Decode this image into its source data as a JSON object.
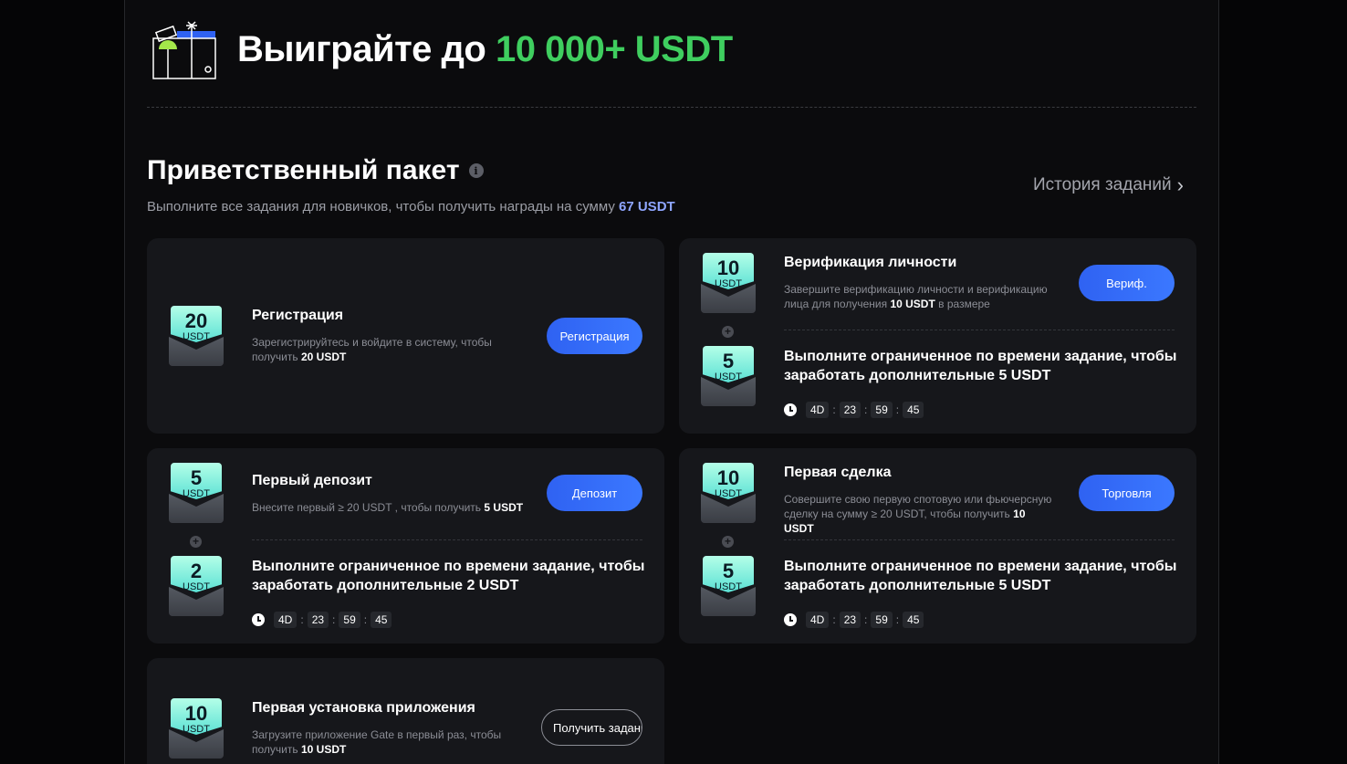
{
  "hero": {
    "title": "Выиграйте до",
    "amount": "10 000+ USDT"
  },
  "section": {
    "title": "Приветственный пакет",
    "subtitle": "Выполните все задания для новичков, чтобы получить награды на сумму",
    "subtitle_amount": "67 USDT",
    "history_label": "История заданий"
  },
  "colors": {
    "accent_green": "#3fce5f",
    "button_blue": "#3b78ff",
    "highlight": "#8fa6ff"
  },
  "timer": {
    "days": "4D",
    "hours": "23",
    "minutes": "59",
    "seconds": "45"
  },
  "unit": "USDT",
  "tasks": {
    "registration": {
      "reward": "20",
      "title": "Регистрация",
      "desc_pre": "Зарегистрируйтесь и войдите в систему, чтобы получить",
      "desc_bold": "20 USDT",
      "button": "Регистрация"
    },
    "verification": {
      "reward": "10",
      "title": "Верификация личности",
      "desc_pre": "Завершите верификацию личности и верификацию лица для получения",
      "desc_bold": "10 USDT",
      "desc_post": "в размере",
      "button": "Вериф.",
      "bonus_reward": "5",
      "bonus_text": "Выполните ограниченное по времени задание, чтобы заработать дополнительные 5 USDT"
    },
    "deposit": {
      "reward": "5",
      "title": "Первый депозит",
      "desc_pre": "Внесите первый ≥ 20 USDT , чтобы получить",
      "desc_bold": "5 USDT",
      "button": "Депозит",
      "bonus_reward": "2",
      "bonus_text": "Выполните ограниченное по времени задание, чтобы заработать дополнительные 2 USDT"
    },
    "trade": {
      "reward": "10",
      "title": "Первая сделка",
      "desc_pre": "Совершите свою первую спотовую или фьючерсную сделку на сумму ≥ 20 USDT, чтобы получить",
      "desc_bold": "10 USDT",
      "button": "Торговля",
      "bonus_reward": "5",
      "bonus_text": "Выполните ограниченное по времени задание, чтобы заработать дополнительные 5 USDT"
    },
    "app_install": {
      "reward": "10",
      "title": "Первая установка приложения",
      "desc_pre": "Загрузите приложение Gate в первый раз, чтобы получить",
      "desc_bold": "10 USDT",
      "button": "Получить задание"
    }
  }
}
